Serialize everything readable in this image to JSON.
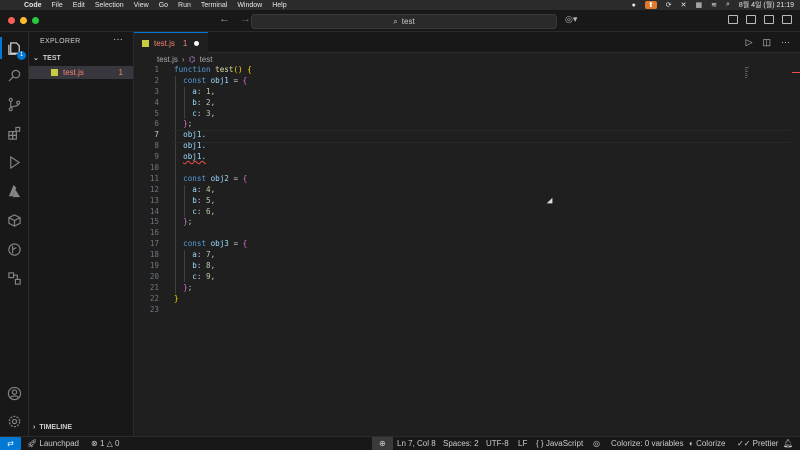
{
  "menubar": {
    "apple": "",
    "items": [
      "Code",
      "File",
      "Edit",
      "Selection",
      "View",
      "Go",
      "Run",
      "Terminal",
      "Window",
      "Help"
    ],
    "clock": "8월 4일 (월) 21:19"
  },
  "titlebar": {
    "search_text": "test",
    "search_icon": "search-icon",
    "traffic_colors": [
      "#ff5f57",
      "#febc2e",
      "#28c840"
    ]
  },
  "activity": {
    "explorer_badge": "1"
  },
  "sidebar": {
    "header": "EXPLORER",
    "more": "···",
    "folder": "TEST",
    "file_name": "test.js",
    "file_problems": "1",
    "timeline": "TIMELINE"
  },
  "editor": {
    "tab_name": "test.js",
    "tab_problems": "1",
    "breadcrumb_file": "test.js",
    "breadcrumb_symbol": "test",
    "line_numbers": [
      "1",
      "2",
      "3",
      "4",
      "5",
      "6",
      "7",
      "8",
      "9",
      "10",
      "11",
      "12",
      "13",
      "14",
      "15",
      "16",
      "17",
      "18",
      "19",
      "20",
      "21",
      "22",
      "23"
    ],
    "current_line": 7,
    "code": {
      "kw_function": "function",
      "fn_name": "test",
      "kw_const": "const",
      "obj1": "obj1",
      "obj2": "obj2",
      "obj3": "obj3",
      "a": "a",
      "b": "b",
      "c": "c",
      "v1": "1",
      "v2": "2",
      "v3": "3",
      "v4": "4",
      "v5": "5",
      "v6": "6",
      "v7": "7",
      "v8": "8",
      "v9": "9",
      "obj1_dot": "obj1."
    }
  },
  "status": {
    "launchpad": "Launchpad",
    "errors": "1",
    "warnings": "0",
    "position": "Ln 7, Col 8",
    "spaces": "Spaces: 2",
    "encoding": "UTF-8",
    "eol": "LF",
    "language": "JavaScript",
    "colorize_vars": "Colorize: 0 variables",
    "colorize": "Colorize",
    "prettier": "Prettier"
  }
}
